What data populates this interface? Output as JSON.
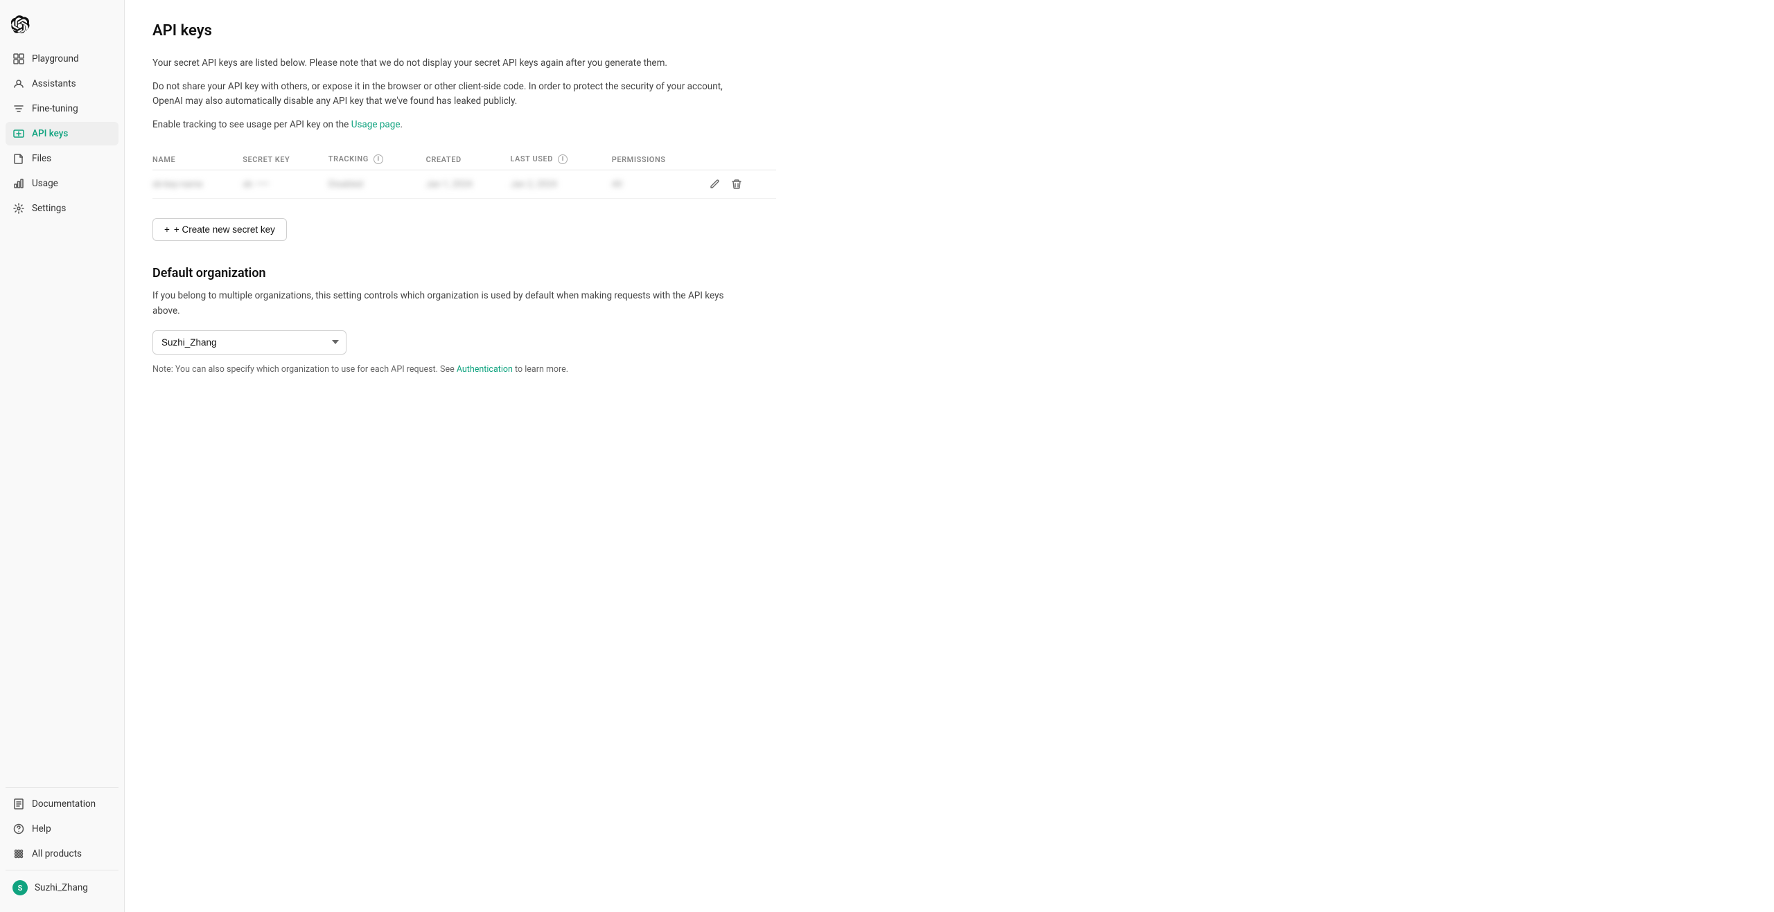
{
  "sidebar": {
    "logo_alt": "OpenAI logo",
    "items": [
      {
        "id": "playground",
        "label": "Playground",
        "icon": "playground",
        "active": false
      },
      {
        "id": "assistants",
        "label": "Assistants",
        "icon": "assistants",
        "active": false
      },
      {
        "id": "fine-tuning",
        "label": "Fine-tuning",
        "icon": "fine-tuning",
        "active": false
      },
      {
        "id": "api-keys",
        "label": "API keys",
        "icon": "api-keys",
        "active": true
      },
      {
        "id": "files",
        "label": "Files",
        "icon": "files",
        "active": false
      },
      {
        "id": "usage",
        "label": "Usage",
        "icon": "usage",
        "active": false
      },
      {
        "id": "settings",
        "label": "Settings",
        "icon": "settings",
        "active": false
      }
    ],
    "bottom_items": [
      {
        "id": "documentation",
        "label": "Documentation",
        "icon": "docs"
      },
      {
        "id": "help",
        "label": "Help",
        "icon": "help"
      },
      {
        "id": "all-products",
        "label": "All products",
        "icon": "all-products"
      }
    ],
    "user": {
      "name": "Suzhi_Zhang",
      "initial": "S"
    }
  },
  "main": {
    "page_title": "API keys",
    "description_1": "Your secret API keys are listed below. Please note that we do not display your secret API keys again after you generate them.",
    "description_2": "Do not share your API key with others, or expose it in the browser or other client-side code. In order to protect the security of your account, OpenAI may also automatically disable any API key that we've found has leaked publicly.",
    "tracking_text": "Enable tracking to see usage per API key on the ",
    "usage_page_link": "Usage page",
    "tracking_suffix": ".",
    "table": {
      "columns": [
        {
          "id": "name",
          "label": "NAME"
        },
        {
          "id": "secret_key",
          "label": "SECRET KEY"
        },
        {
          "id": "tracking",
          "label": "TRACKING",
          "has_info": true
        },
        {
          "id": "created",
          "label": "CREATED"
        },
        {
          "id": "last_used",
          "label": "LAST USED",
          "has_info": true
        },
        {
          "id": "permissions",
          "label": "PERMISSIONS"
        }
      ],
      "rows": [
        {
          "name": "••••••••",
          "secret_key": "sk- ••••",
          "tracking": "••••••••",
          "created": "••••• •••••",
          "last_used": "••••• ••••••",
          "permissions": "••"
        }
      ]
    },
    "create_button": "+ Create new secret key",
    "default_org_section": {
      "title": "Default organization",
      "description": "If you belong to multiple organizations, this setting controls which organization is used by default when making requests with the API keys above.",
      "org_select_value": "Suzhi_Zhang",
      "org_options": [
        "Suzhi_Zhang"
      ]
    },
    "note_prefix": "Note: You can also specify which organization to use for each API request. See ",
    "note_link": "Authentication",
    "note_suffix": " to learn more."
  }
}
